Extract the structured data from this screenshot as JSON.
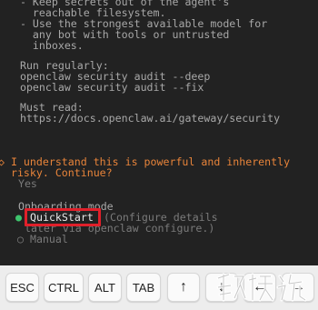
{
  "terminal": {
    "lines_top": [
      "  - Keep secrets out of the agent's",
      "    reachable filesystem.",
      "  - Use the strongest available model for",
      "    any bot with tools or untrusted",
      "    inboxes.",
      "",
      "  Run regularly:",
      "  openclaw security audit --deep",
      "  openclaw security audit --fix",
      "",
      "  Must read:",
      "  https://docs.openclaw.ai/gateway/security"
    ],
    "prompt_line1": "◇ I understand this is powerful and inherently",
    "prompt_line2": "  risky. Continue?",
    "answer_yes": "  Yes",
    "onboarding_label": "  Onboarding mode",
    "selected_marker": "●",
    "selected_option": "QuickStart",
    "selected_hint": " (Configure details",
    "selected_hint2": "  later via openclaw configure.)",
    "other_option": "○ Manual"
  },
  "keybar": {
    "keys": [
      "ESC",
      "CTRL",
      "ALT",
      "TAB",
      "↑",
      "↓",
      "←",
      "→"
    ]
  },
  "watermark": {
    "text": "游戏狗"
  },
  "colors": {
    "prompt": "#e8843a",
    "selected_dot": "#3ec46d",
    "highlight_box": "#e0202a"
  }
}
